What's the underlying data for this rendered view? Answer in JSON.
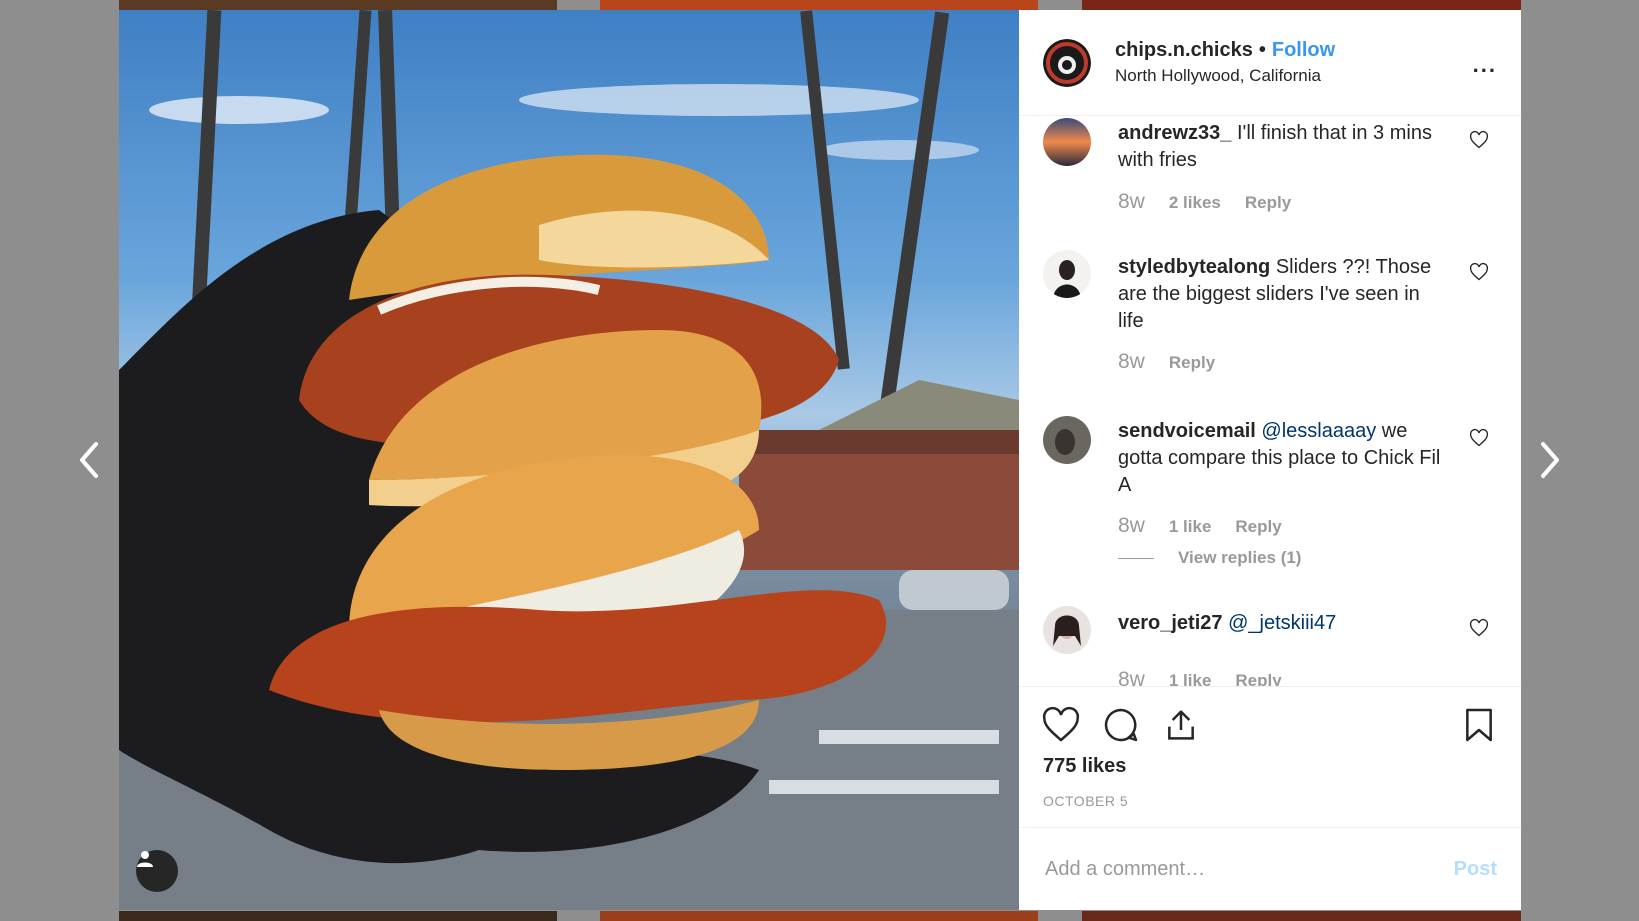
{
  "colors": {
    "accent": "#3897f0",
    "mention": "#003569",
    "muted": "#999999",
    "post_disabled": "#b2dffc"
  },
  "nav": {
    "prev_icon": "chevron-left-icon",
    "next_icon": "chevron-right-icon"
  },
  "post": {
    "username": "chips.n.chicks",
    "separator": "•",
    "follow_label": "Follow",
    "location": "North Hollywood, California",
    "more_label": "..."
  },
  "comments": [
    {
      "user": "andrewz33_",
      "mention": "",
      "text": "I'll finish that in 3 mins with fries",
      "time": "8w",
      "likes": "2 likes",
      "reply": "Reply"
    },
    {
      "user": "styledbytealong",
      "mention": "",
      "text": "Sliders ??! Those are the biggest sliders I've seen in life",
      "time": "8w",
      "likes": "",
      "reply": "Reply"
    },
    {
      "user": "sendvoicemail",
      "mention": "@lesslaaaay",
      "text": "we gotta compare this place to Chick Fil A",
      "time": "8w",
      "likes": "1 like",
      "reply": "Reply",
      "view_replies": "View replies (1)"
    },
    {
      "user": "vero_jeti27",
      "mention": "@_jetskiii47",
      "text": "",
      "time": "8w",
      "likes": "1 like",
      "reply": "Reply"
    }
  ],
  "actions": {
    "like_count": "775 likes",
    "date": "OCTOBER 5"
  },
  "composer": {
    "placeholder": "Add a comment…",
    "post_label": "Post"
  }
}
